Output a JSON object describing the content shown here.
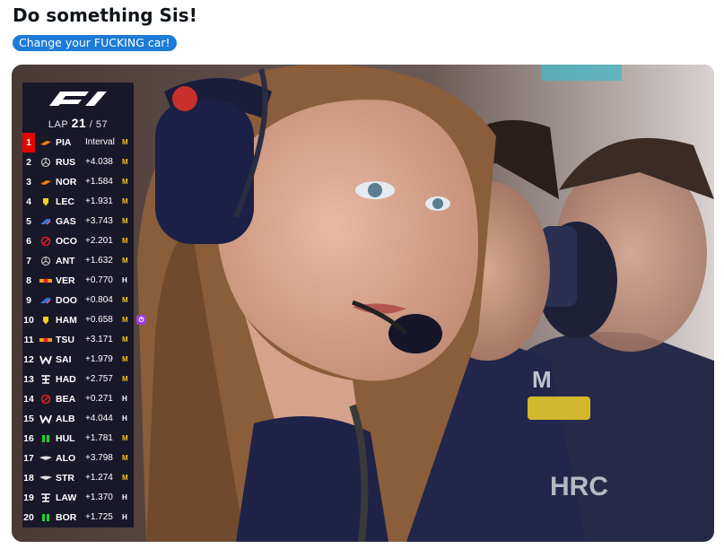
{
  "post": {
    "title": "Do something Sis!",
    "tag": "Change your FUCKING car!"
  },
  "colors": {
    "tag_bg": "#1d7bd7",
    "tower_bg": "#141628",
    "leader_bg": "#e10600",
    "medium_tyre": "#f2c318",
    "hard_tyre": "#ffffff",
    "fastest_lap": "#a13ce0"
  },
  "timing_tower": {
    "logo": "F1",
    "lap_label": "LAP",
    "lap_current": "21",
    "lap_total": "/ 57",
    "rows": [
      {
        "pos": "1",
        "icon": "mclaren-icon",
        "code": "PIA",
        "gap": "Interval",
        "tyre": "M"
      },
      {
        "pos": "2",
        "icon": "mercedes-icon",
        "code": "RUS",
        "gap": "+4.038",
        "tyre": "M"
      },
      {
        "pos": "3",
        "icon": "mclaren-icon",
        "code": "NOR",
        "gap": "+1.584",
        "tyre": "M"
      },
      {
        "pos": "4",
        "icon": "ferrari-icon",
        "code": "LEC",
        "gap": "+1.931",
        "tyre": "M"
      },
      {
        "pos": "5",
        "icon": "alpine-icon",
        "code": "GAS",
        "gap": "+3.743",
        "tyre": "M"
      },
      {
        "pos": "6",
        "icon": "haas-icon",
        "code": "OCO",
        "gap": "+2.201",
        "tyre": "M"
      },
      {
        "pos": "7",
        "icon": "mercedes-icon",
        "code": "ANT",
        "gap": "+1.632",
        "tyre": "M"
      },
      {
        "pos": "8",
        "icon": "redbull-icon",
        "code": "VER",
        "gap": "+0.770",
        "tyre": "H"
      },
      {
        "pos": "9",
        "icon": "alpine-icon",
        "code": "DOO",
        "gap": "+0.804",
        "tyre": "M"
      },
      {
        "pos": "10",
        "icon": "ferrari-icon",
        "code": "HAM",
        "gap": "+0.658",
        "tyre": "M",
        "fastest": true
      },
      {
        "pos": "11",
        "icon": "redbull-icon",
        "code": "TSU",
        "gap": "+3.171",
        "tyre": "M"
      },
      {
        "pos": "12",
        "icon": "williams-icon",
        "code": "SAI",
        "gap": "+1.979",
        "tyre": "M"
      },
      {
        "pos": "13",
        "icon": "racingbulls-icon",
        "code": "HAD",
        "gap": "+2.757",
        "tyre": "M"
      },
      {
        "pos": "14",
        "icon": "haas-icon",
        "code": "BEA",
        "gap": "+0.271",
        "tyre": "H"
      },
      {
        "pos": "15",
        "icon": "williams-icon",
        "code": "ALB",
        "gap": "+4.044",
        "tyre": "H"
      },
      {
        "pos": "16",
        "icon": "sauber-icon",
        "code": "HUL",
        "gap": "+1.781",
        "tyre": "M"
      },
      {
        "pos": "17",
        "icon": "astonmartin-icon",
        "code": "ALO",
        "gap": "+3.798",
        "tyre": "M"
      },
      {
        "pos": "18",
        "icon": "astonmartin-icon",
        "code": "STR",
        "gap": "+1.274",
        "tyre": "M"
      },
      {
        "pos": "19",
        "icon": "racingbulls-icon",
        "code": "LAW",
        "gap": "+1.370",
        "tyre": "H"
      },
      {
        "pos": "20",
        "icon": "sauber-icon",
        "code": "BOR",
        "gap": "+1.725",
        "tyre": "H"
      }
    ]
  }
}
